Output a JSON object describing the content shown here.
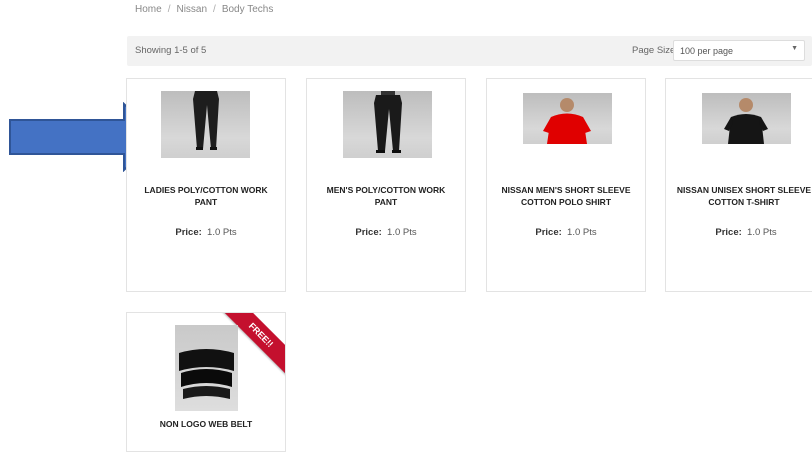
{
  "breadcrumb": {
    "items": [
      "Home",
      "Nissan",
      "Body Techs"
    ],
    "separator": "/"
  },
  "results": {
    "showing": "Showing 1-5 of 5",
    "page_size_label": "Page Size",
    "page_size_value": "100 per page"
  },
  "price_label": "Price:",
  "products": [
    {
      "name": "LADIES POLY/COTTON WORK PANT",
      "price": "1.0 Pts"
    },
    {
      "name": "MEN'S POLY/COTTON WORK PANT",
      "price": "1.0 Pts"
    },
    {
      "name": "NISSAN MEN'S SHORT SLEEVE COTTON POLO SHIRT",
      "price": "1.0 Pts"
    },
    {
      "name": "NISSAN UNISEX SHORT SLEEVE COTTON T-SHIRT",
      "price": "1.0 Pts"
    },
    {
      "name": "NON LOGO WEB BELT",
      "ribbon": "FREE!!"
    }
  ],
  "colors": {
    "arrow_fill": "#4472c4",
    "arrow_stroke": "#2f5597",
    "ribbon": "#c4102e",
    "polo": "#e00000"
  }
}
